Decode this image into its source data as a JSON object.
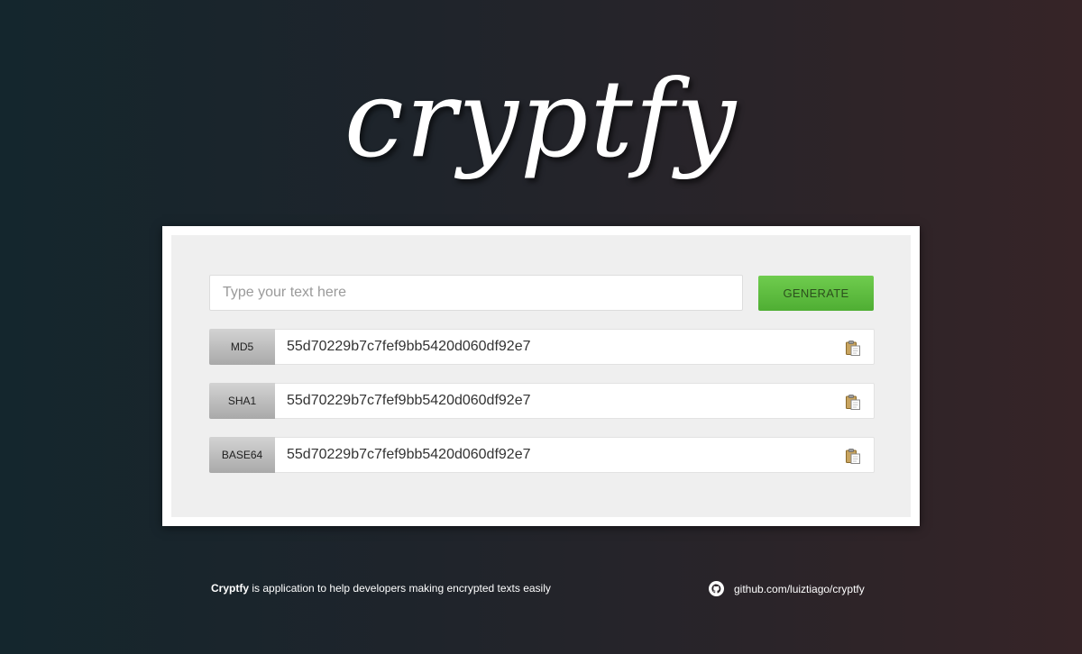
{
  "app": {
    "logo_text": "cryptfy"
  },
  "form": {
    "input_placeholder": "Type your text here",
    "input_value": "",
    "generate_label": "GENERATE"
  },
  "results": [
    {
      "label": "MD5",
      "value": "55d70229b7c7fef9bb5420d060df92e7",
      "icon": "clipboard-icon"
    },
    {
      "label": "SHA1",
      "value": "55d70229b7c7fef9bb5420d060df92e7",
      "icon": "clipboard-icon"
    },
    {
      "label": "BASE64",
      "value": "55d70229b7c7fef9bb5420d060df92e7",
      "icon": "clipboard-icon"
    }
  ],
  "footer": {
    "brand": "Cryptfy",
    "tagline": " is application to help developers making encrypted texts easily",
    "github_icon": "github-icon",
    "github_link": "github.com/luiztiago/cryptfy"
  },
  "colors": {
    "accent_green": "#5bbd3d",
    "background_left": "#14262d",
    "background_right": "#362427"
  }
}
